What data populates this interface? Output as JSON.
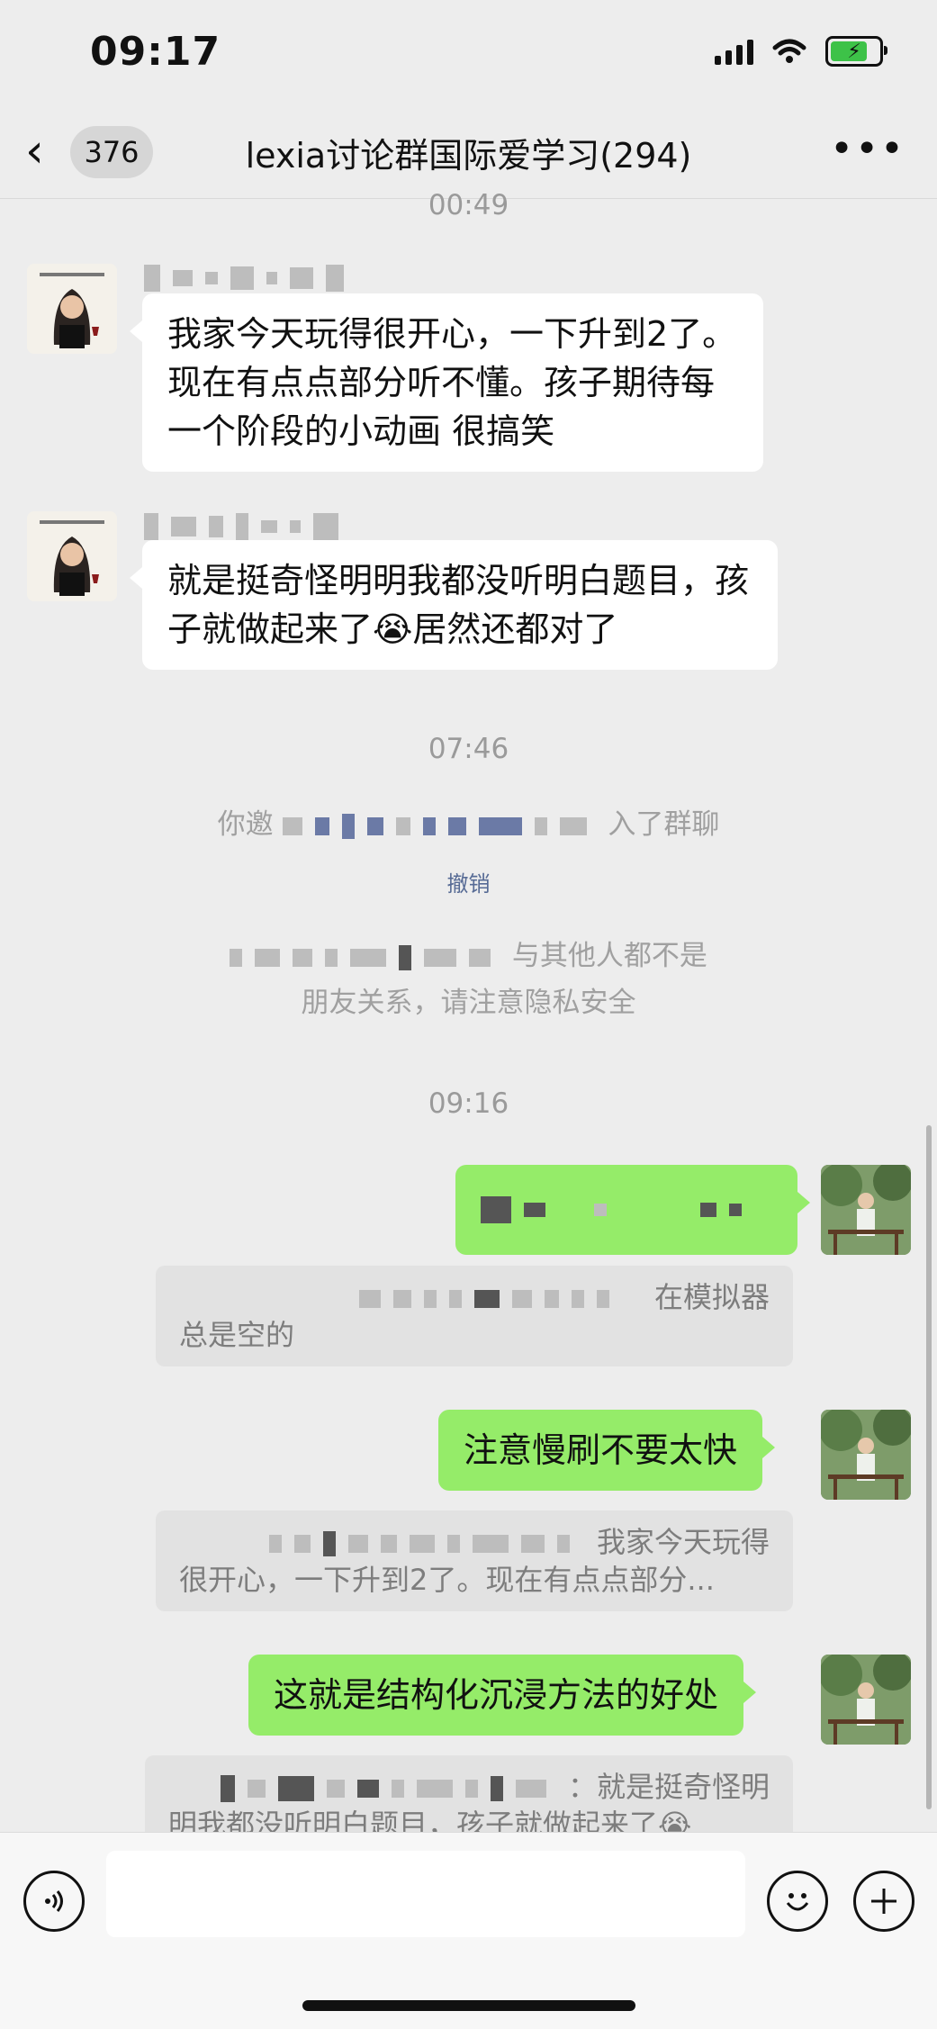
{
  "status_bar": {
    "time": "09:17"
  },
  "nav": {
    "back_count": "376",
    "title": "lexia讨论群国际爱学习(294)",
    "more_icon": "more-icon"
  },
  "messages": {
    "ts1": "00:49",
    "m1_text": "我家今天玩得很开心，一下升到2了。现在有点点部分听不懂。孩子期待每一个阶段的小动画 很搞笑",
    "m2_text_a": "就是挺奇怪明明我都没听明白题目，孩子就做起来了",
    "m2_emoji": "😭",
    "m2_text_b": "居然还都对了",
    "ts2": "07:46",
    "sys1_prefix": "你邀",
    "sys1_suffix": "入了群聊",
    "sys1_revoke": "撤销",
    "sys2_suffix": "与其他人都不是",
    "sys2_line2": "朋友关系，请注意隐私安全",
    "ts3": "09:16",
    "q1_tail": "在模拟器",
    "q1_line2": "总是空的",
    "o2_text": "注意慢刷不要太快",
    "q2_tail": "我家今天玩得",
    "q2_line2": "很开心，一下升到2了。现在有点点部分...",
    "o3_text": "这就是结构化沉浸方法的好处",
    "q3_tail": "：就是挺奇怪明",
    "q3_line2": "明我都没听明白题目，孩子就做起来了😭"
  },
  "colors": {
    "accent_green": "#95ec69",
    "background": "#ededed"
  }
}
